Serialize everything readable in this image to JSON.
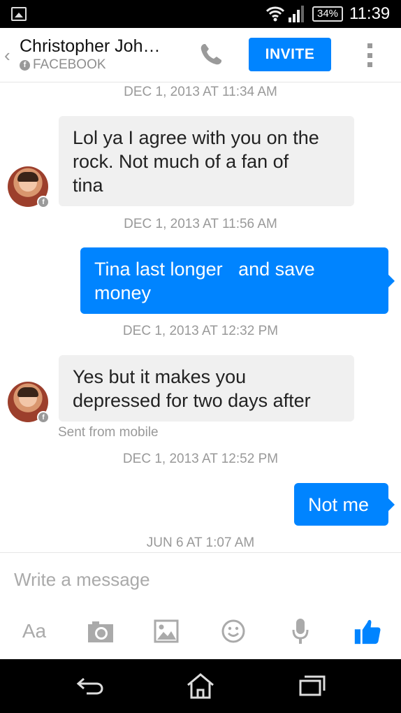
{
  "status_bar": {
    "battery": "34%",
    "time": "11:39"
  },
  "header": {
    "contact_name": "Christopher Joh…",
    "subtitle": "FACEBOOK",
    "invite_label": "INVITE"
  },
  "messages": [
    {
      "timestamp": "DEC 1, 2013 AT 11:34 AM",
      "direction": "incoming",
      "line1": "Lol ya I agree with you on the",
      "line2": "rock. Not much of a fan of",
      "line3": "tina"
    },
    {
      "timestamp": "DEC 1, 2013 AT 11:56 AM",
      "direction": "outgoing",
      "line1": "Tina last longer   and save",
      "line2": "money"
    },
    {
      "timestamp": "DEC 1, 2013 AT 12:32 PM",
      "direction": "incoming",
      "line1": "Yes but it makes you",
      "line2": "depressed for two days after",
      "footer": "Sent from mobile"
    },
    {
      "timestamp": "DEC 1, 2013 AT 12:52 PM",
      "direction": "outgoing",
      "line1": "Not me"
    },
    {
      "timestamp": "JUN 6 AT 1:07 AM"
    }
  ],
  "composer": {
    "placeholder": "Write a message",
    "text_tool_label": "Aa"
  },
  "colors": {
    "accent": "#0084ff",
    "incoming_bubble": "#f0f0f0",
    "muted_text": "#999999"
  },
  "icons": [
    "gallery-icon",
    "wifi-icon",
    "signal-icon",
    "back-chevron-icon",
    "facebook-icon",
    "phone-icon",
    "overflow-menu-icon",
    "camera-icon",
    "image-icon",
    "emoji-icon",
    "microphone-icon",
    "thumbs-up-icon",
    "back-nav-icon",
    "home-nav-icon",
    "recents-nav-icon"
  ]
}
